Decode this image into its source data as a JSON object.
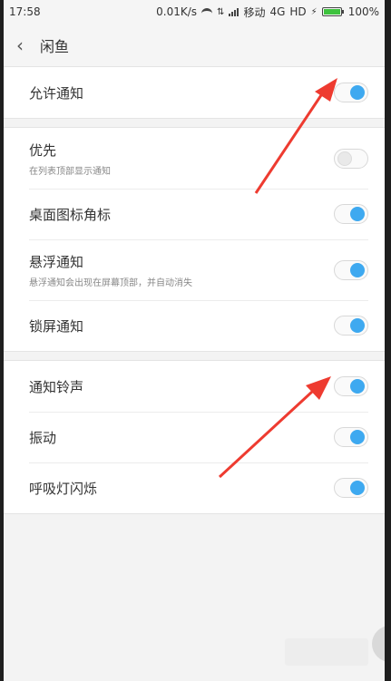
{
  "status_bar": {
    "time": "17:58",
    "speed": "0.01K/s",
    "carrier": "移动",
    "network": "4G",
    "hd": "HD",
    "battery": "100%"
  },
  "header": {
    "back_icon": "chevron-left",
    "title": "闲鱼"
  },
  "settings": {
    "allow": {
      "label": "允许通知",
      "enabled": true
    },
    "priority": {
      "label": "优先",
      "subtitle": "在列表顶部显示通知",
      "enabled": false
    },
    "badge": {
      "label": "桌面图标角标",
      "enabled": true
    },
    "floating": {
      "label": "悬浮通知",
      "subtitle": "悬浮通知会出现在屏幕顶部，并自动消失",
      "enabled": true
    },
    "lockscreen": {
      "label": "锁屏通知",
      "enabled": true
    },
    "ringtone": {
      "label": "通知铃声",
      "enabled": true
    },
    "vibration": {
      "label": "振动",
      "enabled": true
    },
    "breathing_light": {
      "label": "呼吸灯闪烁",
      "enabled": true
    }
  },
  "colors": {
    "toggle_on": "#3ea9f0",
    "arrow": "#ee3b30"
  }
}
